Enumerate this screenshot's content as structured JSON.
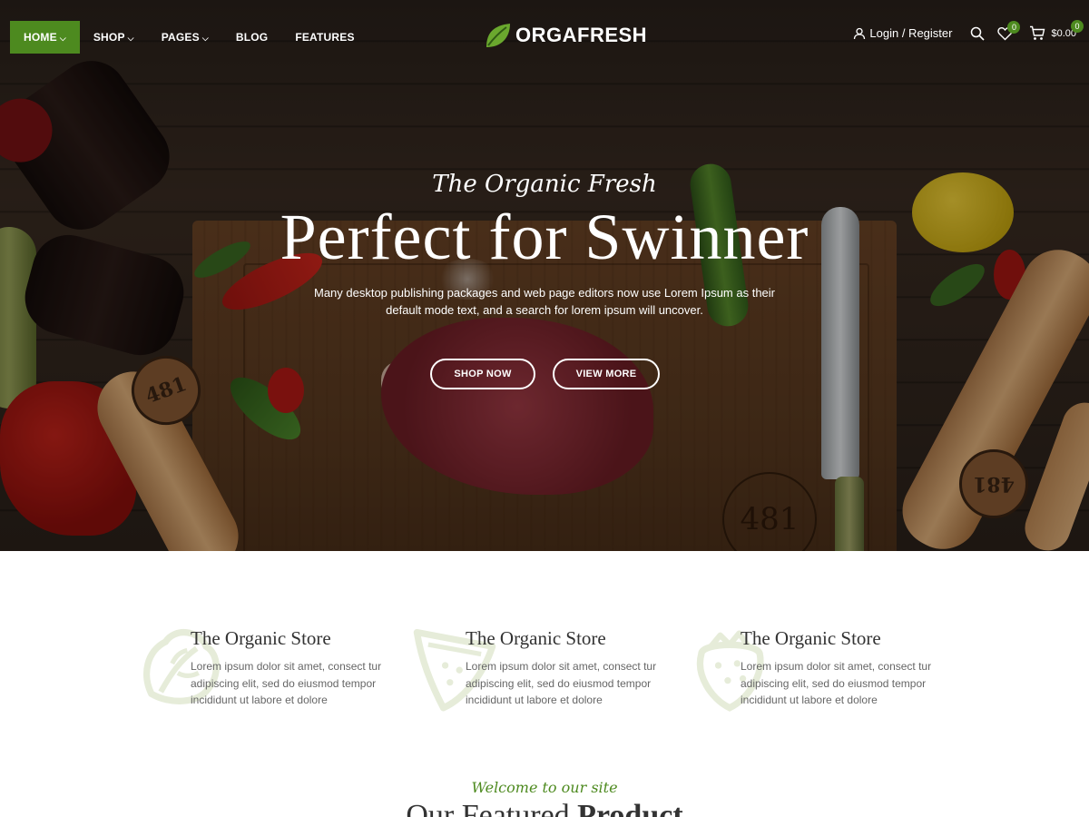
{
  "header": {
    "nav": [
      {
        "label": "HOME",
        "has_caret": true,
        "active": true
      },
      {
        "label": "SHOP",
        "has_caret": true,
        "active": false
      },
      {
        "label": "PAGES",
        "has_caret": true,
        "active": false
      },
      {
        "label": "BLOG",
        "has_caret": false,
        "active": false
      },
      {
        "label": "FEATURES",
        "has_caret": false,
        "active": false
      }
    ],
    "logo_text": "ORGAFRESH",
    "login_label": "Login / Register",
    "wishlist_count": "0",
    "cart_count": "0",
    "cart_total": "$0.00",
    "icons": [
      "user-icon",
      "search-icon",
      "heart-icon",
      "cart-icon",
      "leaf-icon"
    ]
  },
  "hero": {
    "subtitle": "The Organic Fresh",
    "title": "Perfect for Swinner",
    "description": "Many desktop publishing packages and web page editors now use Lorem Ipsum as their default mode text, and a search for lorem ipsum will uncover.",
    "shop_button": "SHOP NOW",
    "view_button": "VIEW MORE",
    "stamp_text": "481"
  },
  "features": [
    {
      "title": "The Organic Store",
      "text": "Lorem ipsum dolor sit amet, consect tur adipiscing elit, sed do eiusmod tempor incididunt ut labore et dolore",
      "icon": "lettuce-icon"
    },
    {
      "title": "The Organic Store",
      "text": "Lorem ipsum dolor sit amet, consect tur adipiscing elit, sed do eiusmod tempor incididunt ut labore et dolore",
      "icon": "watermelon-slice-icon"
    },
    {
      "title": "The Organic Store",
      "text": "Lorem ipsum dolor sit amet, consect tur adipiscing elit, sed do eiusmod tempor incididunt ut labore et dolore",
      "icon": "strawberry-icon"
    }
  ],
  "featured": {
    "welcome": "Welcome to our site",
    "title_plain": "Our Featured",
    "title_bold": "Product"
  },
  "colors": {
    "accent_green": "#4d8a1f",
    "feature_icon": "#e6ecd9"
  }
}
